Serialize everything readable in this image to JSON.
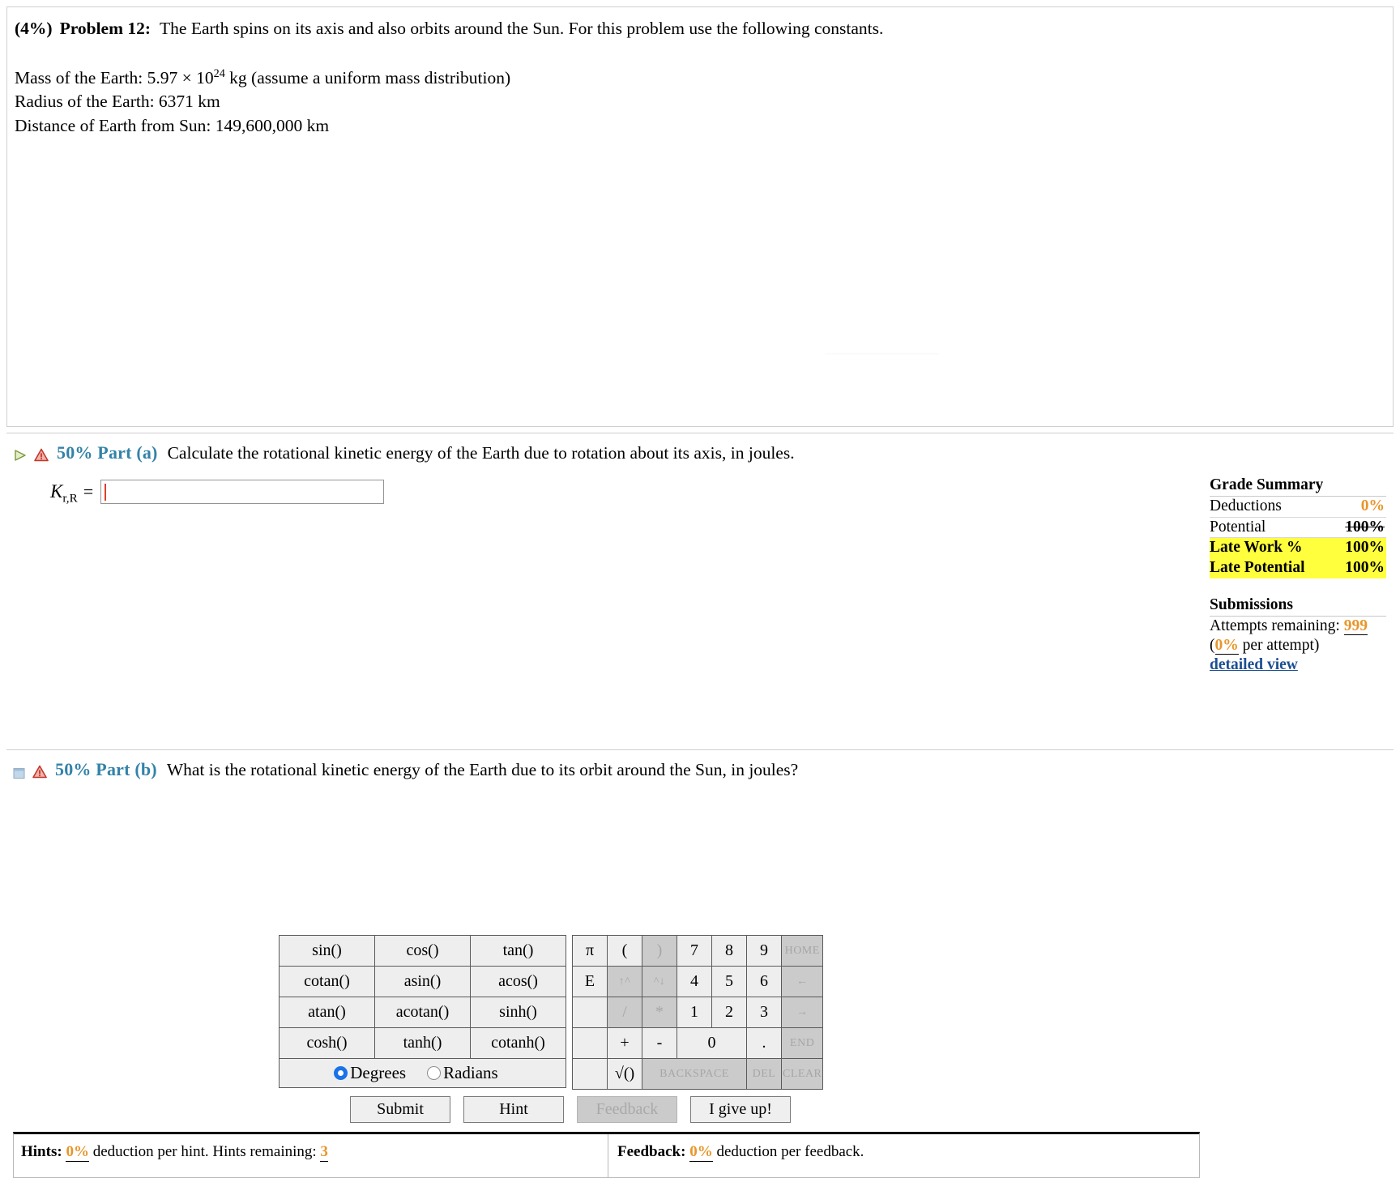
{
  "problem": {
    "weight": "(4%)",
    "label": "Problem 12:",
    "statement": "The Earth spins on its axis and also orbits around the Sun. For this problem use the following constants.",
    "constants": [
      {
        "prefix": "Mass of the Earth: 5.97 × 10",
        "exponent": "24",
        "suffix": " kg (assume a uniform mass distribution)"
      },
      {
        "prefix": "Radius of the Earth: 6371 km",
        "exponent": "",
        "suffix": ""
      },
      {
        "prefix": "Distance of Earth from Sun: 149,600,000 km",
        "exponent": "",
        "suffix": ""
      }
    ]
  },
  "part_a": {
    "icon_play": "play-triangle-icon",
    "icon_warning": "warning-triangle-icon",
    "percent": "50% Part (a)",
    "text": "Calculate the rotational kinetic energy of the Earth due to rotation about its axis, in joules.",
    "answer_var": "K",
    "answer_sub": "r,R",
    "equals": "=",
    "input_value": "",
    "input_placeholder": ""
  },
  "calculator": {
    "functions": [
      [
        "sin()",
        "cos()",
        "tan()"
      ],
      [
        "cotan()",
        "asin()",
        "acos()"
      ],
      [
        "atan()",
        "acotan()",
        "sinh()"
      ],
      [
        "cosh()",
        "tanh()",
        "cotanh()"
      ]
    ],
    "modes": {
      "degrees": "Degrees",
      "radians": "Radians",
      "selected": "Degrees"
    },
    "keys": {
      "row1": [
        "π",
        "(",
        ")",
        "7",
        "8",
        "9",
        "HOME"
      ],
      "row2": [
        "E",
        "↑^",
        "^↓",
        "4",
        "5",
        "6",
        "←"
      ],
      "row3": [
        "",
        "/",
        "*",
        "1",
        "2",
        "3",
        "→"
      ],
      "row4": [
        "",
        "+",
        "-",
        "0",
        ".",
        "END"
      ],
      "row5": [
        "",
        "√()",
        "BACKSPACE",
        "DEL",
        "CLEAR"
      ]
    },
    "disabled_keys": [
      ")",
      "↑^",
      "^↓",
      "/",
      "*",
      "HOME",
      "←",
      "→",
      "END",
      "BACKSPACE",
      "DEL",
      "CLEAR"
    ]
  },
  "buttons": {
    "submit": "Submit",
    "hint": "Hint",
    "feedback": "Feedback",
    "give_up": "I give up!",
    "disabled": [
      "Feedback"
    ]
  },
  "footer": {
    "hints_label": "Hints:",
    "hints_pct": "0%",
    "hints_text_1": "deduction per hint. Hints remaining:",
    "hints_remaining": "3",
    "feedback_label": "Feedback:",
    "feedback_pct": "0%",
    "feedback_text": "deduction per feedback."
  },
  "part_b": {
    "icon_box": "collapsed-box-icon",
    "icon_warning": "warning-triangle-icon",
    "percent": "50% Part (b)",
    "text": "What is the rotational kinetic energy of the Earth due to its orbit around the Sun, in joules?"
  },
  "grade_summary": {
    "title": "Grade Summary",
    "rows": [
      {
        "label": "Deductions",
        "value": "0%",
        "style": "orange"
      },
      {
        "label": "Potential",
        "value": "100%",
        "style": "strike"
      },
      {
        "label": "Late Work %",
        "value": "100%",
        "style": "highlight"
      },
      {
        "label": "Late Potential",
        "value": "100%",
        "style": "highlight"
      }
    ],
    "submissions_title": "Submissions",
    "attempts_label": "Attempts remaining:",
    "attempts_value": "999",
    "per_attempt_open": "(",
    "per_attempt_pct": "0%",
    "per_attempt_rest": " per attempt)",
    "detailed_view": "detailed view"
  },
  "colors": {
    "accent_blue": "#3382a8",
    "orange": "#e8962b",
    "highlight_yellow": "#ffff3d",
    "link_blue": "#1d4f91",
    "caret_red": "#e03c31"
  }
}
